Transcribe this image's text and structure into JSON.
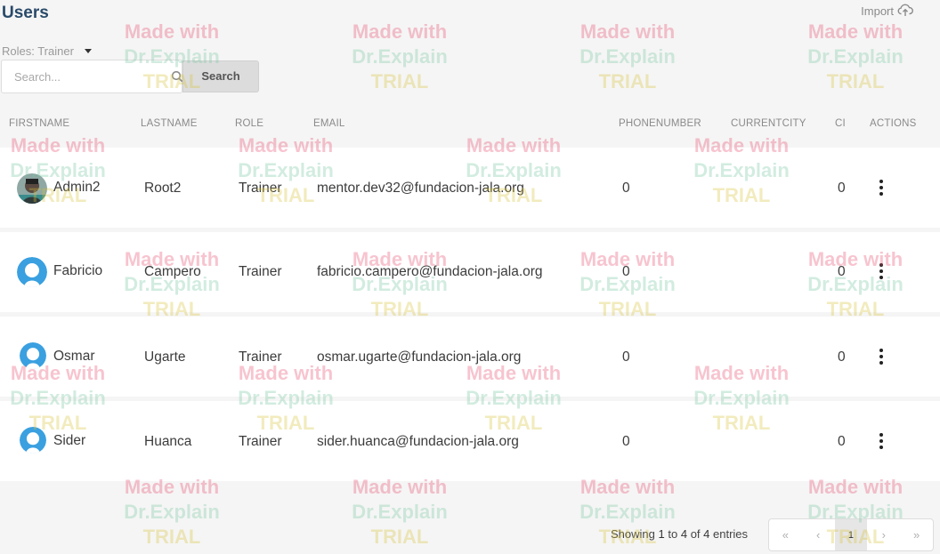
{
  "header": {
    "title": "Users",
    "import_label": "Import"
  },
  "filters": {
    "role_label": "Roles: Trainer"
  },
  "search": {
    "placeholder": "Search...",
    "button_label": "Search"
  },
  "table": {
    "columns": [
      "FIRSTNAME",
      "LASTNAME",
      "ROLE",
      "EMAIL",
      "PHONENUMBER",
      "CURRENTCITY",
      "CI",
      "ACTIONS"
    ],
    "rows": [
      {
        "firstname": "Admin2",
        "lastname": "Root2",
        "role": "Trainer",
        "email": "mentor.dev32@fundacion-jala.org",
        "phone": "0",
        "city": "",
        "ci": "0",
        "avatar": "photo-avatar"
      },
      {
        "firstname": "Fabricio",
        "lastname": "Campero",
        "role": "Trainer",
        "email": "fabricio.campero@fundacion-jala.org",
        "phone": "0",
        "city": "",
        "ci": "0",
        "avatar": "default-avatar"
      },
      {
        "firstname": "Osmar",
        "lastname": "Ugarte",
        "role": "Trainer",
        "email": "osmar.ugarte@fundacion-jala.org",
        "phone": "0",
        "city": "",
        "ci": "0",
        "avatar": "default-avatar"
      },
      {
        "firstname": "Sider",
        "lastname": "Huanca",
        "role": "Trainer",
        "email": "sider.huanca@fundacion-jala.org",
        "phone": "0",
        "city": "",
        "ci": "0",
        "avatar": "default-avatar"
      }
    ]
  },
  "footer": {
    "showing_prefix": "Showing",
    "from": "1",
    "to_word": "to",
    "to": "4",
    "of_word": "of",
    "total": "4",
    "entries_word": "entries",
    "pager": {
      "first": "«",
      "prev": "‹",
      "page": "1",
      "next": "›",
      "last": "»"
    }
  },
  "watermark": {
    "line1": "Made with",
    "line2": "Dr.Explain",
    "line3": "TRIAL"
  },
  "colors": {
    "title": "#2a4a6a",
    "avatar_blue": "#3aa0e0",
    "row_bg": "#ffffff",
    "page_bg": "#f5f5f5"
  }
}
